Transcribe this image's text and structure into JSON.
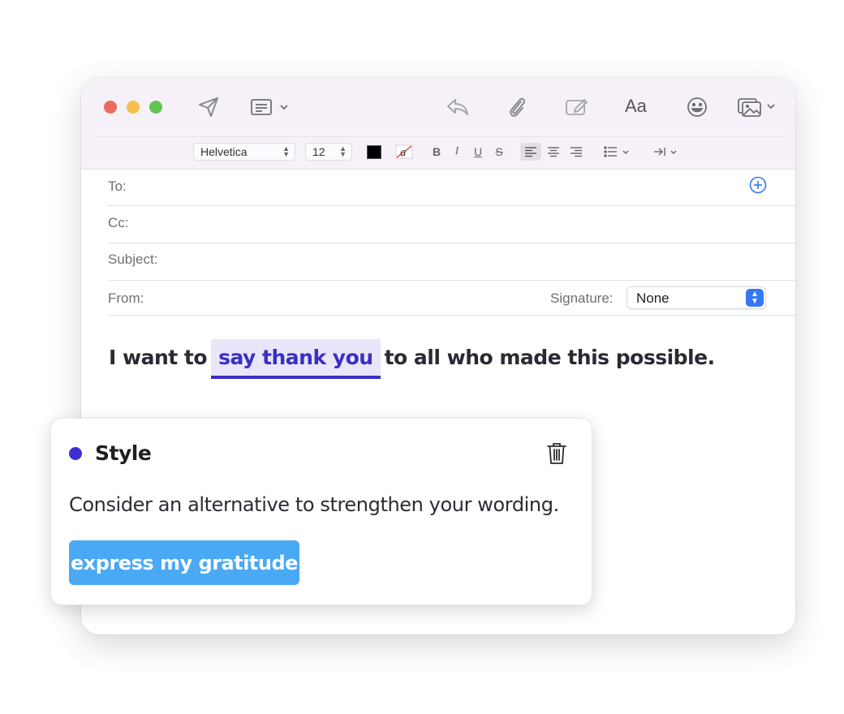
{
  "toolbar": {
    "traffic_lights": {
      "close": "#ed6a5e",
      "minimize": "#f5bf4f",
      "zoom": "#61c554"
    },
    "icons": [
      "send-icon",
      "header-fields-icon",
      "reply-icon",
      "attachment-icon",
      "markup-icon",
      "format-text-icon",
      "emoji-icon",
      "photo-browser-icon"
    ],
    "format_label": "Aa"
  },
  "format_bar": {
    "font": "Helvetica",
    "size": "12",
    "bold": "B",
    "italic": "I",
    "underline": "U",
    "strike": "S",
    "text_color": "#000000"
  },
  "headers": {
    "to_label": "To:",
    "cc_label": "Cc:",
    "subject_label": "Subject:",
    "from_label": "From:",
    "signature_label": "Signature:",
    "signature_value": "None"
  },
  "body": {
    "before": "I want to",
    "highlight": "say thank you",
    "after": "to all who made this possible."
  },
  "suggestion": {
    "category": "Style",
    "category_color": "#3e2fd0",
    "message": "Consider an alternative to strengthen your wording.",
    "replacement": "express my gratitude",
    "accent": "#49a9f5"
  }
}
